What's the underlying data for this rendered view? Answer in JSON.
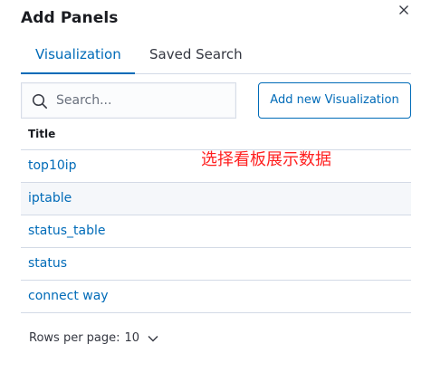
{
  "panel": {
    "title": "Add Panels",
    "close_icon": "close-icon"
  },
  "tabs": [
    {
      "label": "Visualization",
      "active": true
    },
    {
      "label": "Saved Search",
      "active": false
    }
  ],
  "search": {
    "placeholder": "Search...",
    "value": "",
    "icon": "search-icon"
  },
  "add_button": {
    "label": "Add new Visualization"
  },
  "table": {
    "column_title": "Title",
    "rows": [
      {
        "title": "top10ip"
      },
      {
        "title": "iptable"
      },
      {
        "title": "status_table"
      },
      {
        "title": "status"
      },
      {
        "title": "connect way"
      }
    ]
  },
  "annotation": {
    "text": "选择看板展示数据",
    "color": "#ff2020"
  },
  "pagination": {
    "rows_per_page_label": "Rows per page:",
    "rows_per_page_value": "10",
    "icon": "chevron-down-icon"
  },
  "colors": {
    "accent": "#006bb8",
    "border": "#d3dae6",
    "row_hover": "#f5f7fa"
  }
}
